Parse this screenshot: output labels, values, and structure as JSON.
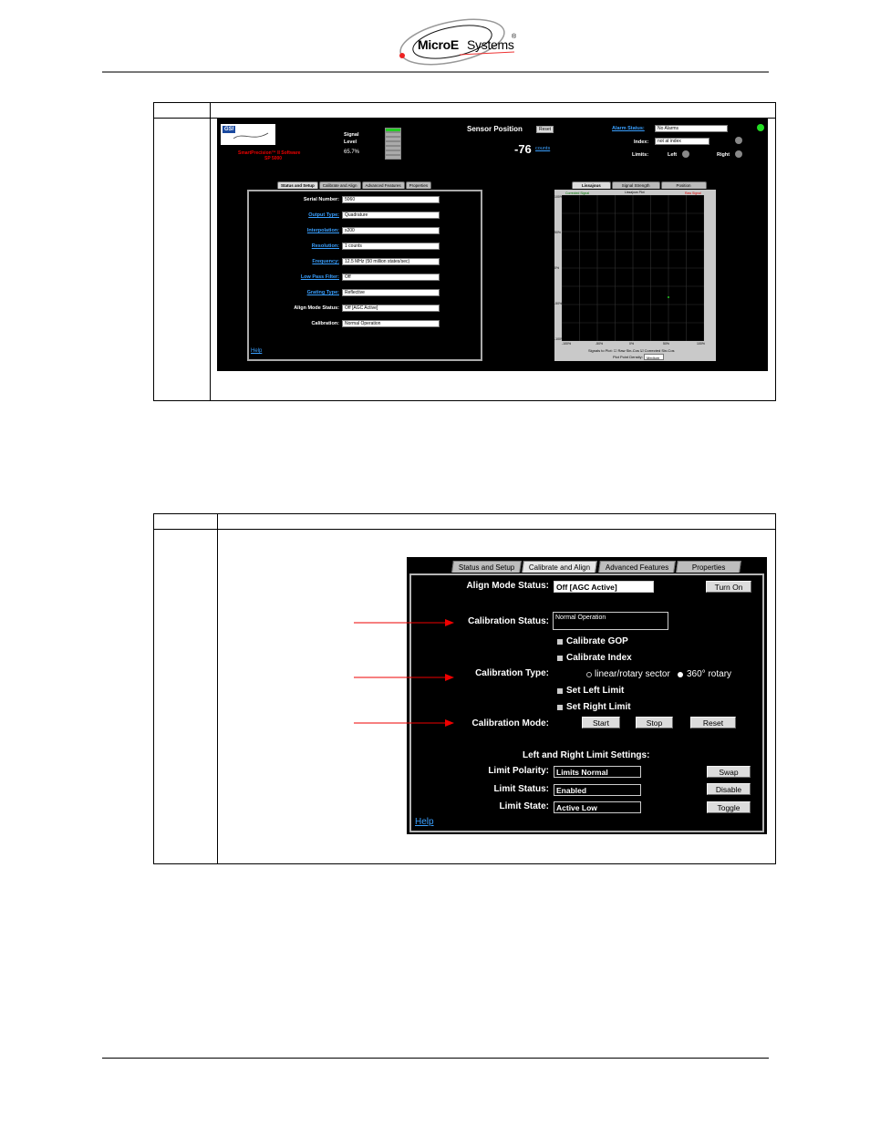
{
  "header": {
    "brand_bold": "MicroE",
    "brand_regular": "Systems",
    "registered": "®"
  },
  "screenshot1": {
    "logo_text": "GSI",
    "software_name": "SmartPrecision™ II Software",
    "model": "SP 5000",
    "signal_label_1": "Signal",
    "signal_label_2": "Level",
    "signal_percent": "65.7%",
    "signal_level_fraction": 0.657,
    "sensor_position_label": "Sensor Position",
    "reset_label": "Reset",
    "position_value": "-76",
    "position_unit": "counts",
    "alarm_status_label": "Alarm Status:",
    "alarm_status_value": "No Alarms",
    "index_label": "Index:",
    "index_value": "not at index",
    "limits_label": "Limits:",
    "left_label": "Left",
    "right_label": "Right",
    "tabs": [
      "Status and Setup",
      "Calibrate and Align",
      "Advanced Features",
      "Properties"
    ],
    "fields": [
      {
        "label": "Serial Number:",
        "value": "5060",
        "link": false
      },
      {
        "label": "Output Type:",
        "value": "Quadrature",
        "link": true
      },
      {
        "label": "Interpolation:",
        "value": "x200",
        "link": true
      },
      {
        "label": "Resolution:",
        "value": "1 counts",
        "link": true
      },
      {
        "label": "Frequency:",
        "value": "12.5 MHz (50 million states/sec)",
        "link": true
      },
      {
        "label": "Low Pass Filter:",
        "value": "Off",
        "link": true
      },
      {
        "label": "Grating Type:",
        "value": "Reflective",
        "link": true
      },
      {
        "label": "Align Mode Status:",
        "value": "Off [AGC Active]",
        "link": false
      },
      {
        "label": "Calibration:",
        "value": "Normal Operation",
        "link": false
      }
    ],
    "help_label": "Help",
    "right_tabs": [
      "Lissajous",
      "Signal Strength",
      "Position"
    ],
    "plot_labels": {
      "left": "Corrected Signal",
      "center": "Lissajous Plot",
      "right": "Raw Signal"
    },
    "plot_y_ticks": [
      "100%",
      "50%",
      "0%",
      "-50%",
      "-100%"
    ],
    "plot_x_ticks": [
      "-100%",
      "-50%",
      "0%",
      "50%",
      "100%"
    ],
    "plot_options": "Signals to Plot:  ☐ Raw Sin-Cos  ☑ Corrected Sin-Cos",
    "plot_rate_label": "Plot Point Density:",
    "plot_rate_value": "Medium"
  },
  "screenshot2": {
    "tabs": [
      "Status and Setup",
      "Calibrate and Align",
      "Advanced Features",
      "Properties"
    ],
    "align_mode_label": "Align Mode Status:",
    "align_mode_value": "Off [AGC Active]",
    "turn_on_label": "Turn On",
    "calibration_status_label": "Calibration Status:",
    "calibration_status_value": "Normal Operation",
    "calibrate_gop_label": "Calibrate GOP",
    "calibrate_index_label": "Calibrate Index",
    "calibration_type_label": "Calibration Type:",
    "type_option_1": "linear/rotary sector",
    "type_option_2": "360° rotary",
    "set_left_limit_label": "Set Left Limit",
    "set_right_limit_label": "Set Right Limit",
    "calibration_mode_label": "Calibration Mode:",
    "start_label": "Start",
    "stop_label": "Stop",
    "reset_label": "Reset",
    "limit_settings_title": "Left and Right Limit Settings:",
    "limit_polarity_label": "Limit Polarity:",
    "limit_polarity_value": "Limits Normal",
    "swap_label": "Swap",
    "limit_status_label": "Limit Status:",
    "limit_status_value": "Enabled",
    "disable_label": "Disable",
    "limit_state_label": "Limit State:",
    "limit_state_value": "Active Low",
    "toggle_label": "Toggle",
    "help_label": "Help"
  }
}
